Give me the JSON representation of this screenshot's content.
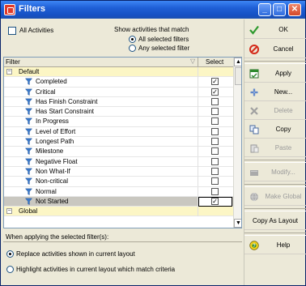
{
  "window": {
    "title": "Filters"
  },
  "options": {
    "all_activities_label": "All Activities",
    "match_label": "Show activities that match",
    "match_options": [
      "All selected filters",
      "Any selected filter"
    ],
    "match_selected": 0
  },
  "grid": {
    "col_filter": "Filter",
    "col_select": "Select",
    "groups": [
      {
        "name": "Default",
        "expand": "−",
        "items": [
          {
            "name": "Completed",
            "checked": true
          },
          {
            "name": "Critical",
            "checked": true
          },
          {
            "name": "Has Finish Constraint",
            "checked": false
          },
          {
            "name": "Has Start Constraint",
            "checked": false
          },
          {
            "name": "In Progress",
            "checked": false
          },
          {
            "name": "Level of Effort",
            "checked": false
          },
          {
            "name": "Longest Path",
            "checked": false
          },
          {
            "name": "Milestone",
            "checked": false
          },
          {
            "name": "Negative Float",
            "checked": false
          },
          {
            "name": "Non What-If",
            "checked": false
          },
          {
            "name": "Non-critical",
            "checked": false
          },
          {
            "name": "Normal",
            "checked": false
          },
          {
            "name": "Not Started",
            "checked": true,
            "selected": true
          }
        ]
      },
      {
        "name": "Global",
        "expand": "−",
        "items": []
      }
    ]
  },
  "apply_options": {
    "heading": "When applying the selected filter(s):",
    "options": [
      "Replace activities shown in current layout",
      "Highlight activities in current layout which match criteria"
    ],
    "selected": 0
  },
  "buttons": {
    "ok": "OK",
    "cancel": "Cancel",
    "apply": "Apply",
    "new": "New...",
    "delete": "Delete",
    "copy": "Copy",
    "paste": "Paste",
    "modify": "Modify...",
    "make_global": "Make Global",
    "copy_as_layout": "Copy As Layout",
    "help": "Help"
  },
  "colors": {
    "group_bg": "#fcf6c5",
    "filter_icon": "#3a78c8",
    "selected_row": "#c9c7c0"
  }
}
